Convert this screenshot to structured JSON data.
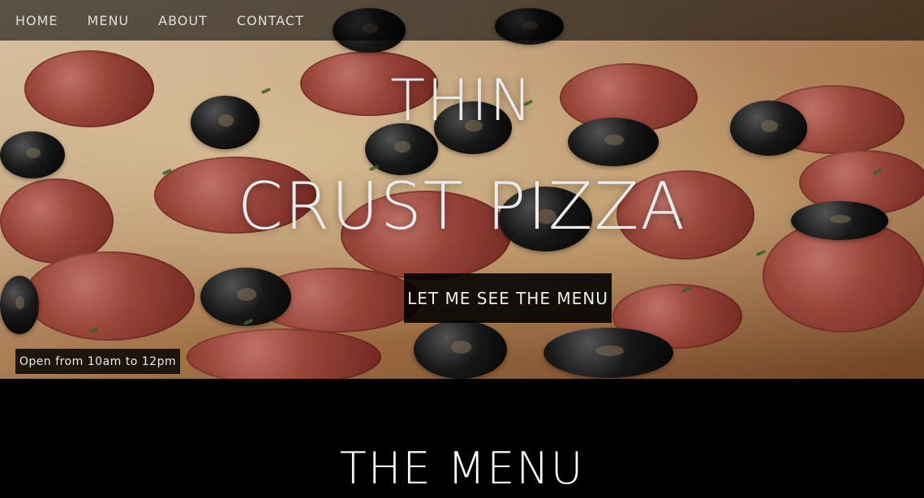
{
  "nav": {
    "items": [
      "HOME",
      "MENU",
      "ABOUT",
      "CONTACT"
    ]
  },
  "hero": {
    "title_line1": "THIN",
    "title_line2": "CRUST PIZZA",
    "cta_label": "Let me see the menu",
    "hours_label": "Open from 10am to 12pm"
  },
  "menu_section": {
    "title": "THE MENU"
  },
  "colors": {
    "overlay": "#000000",
    "text": "#FFFFFF"
  }
}
